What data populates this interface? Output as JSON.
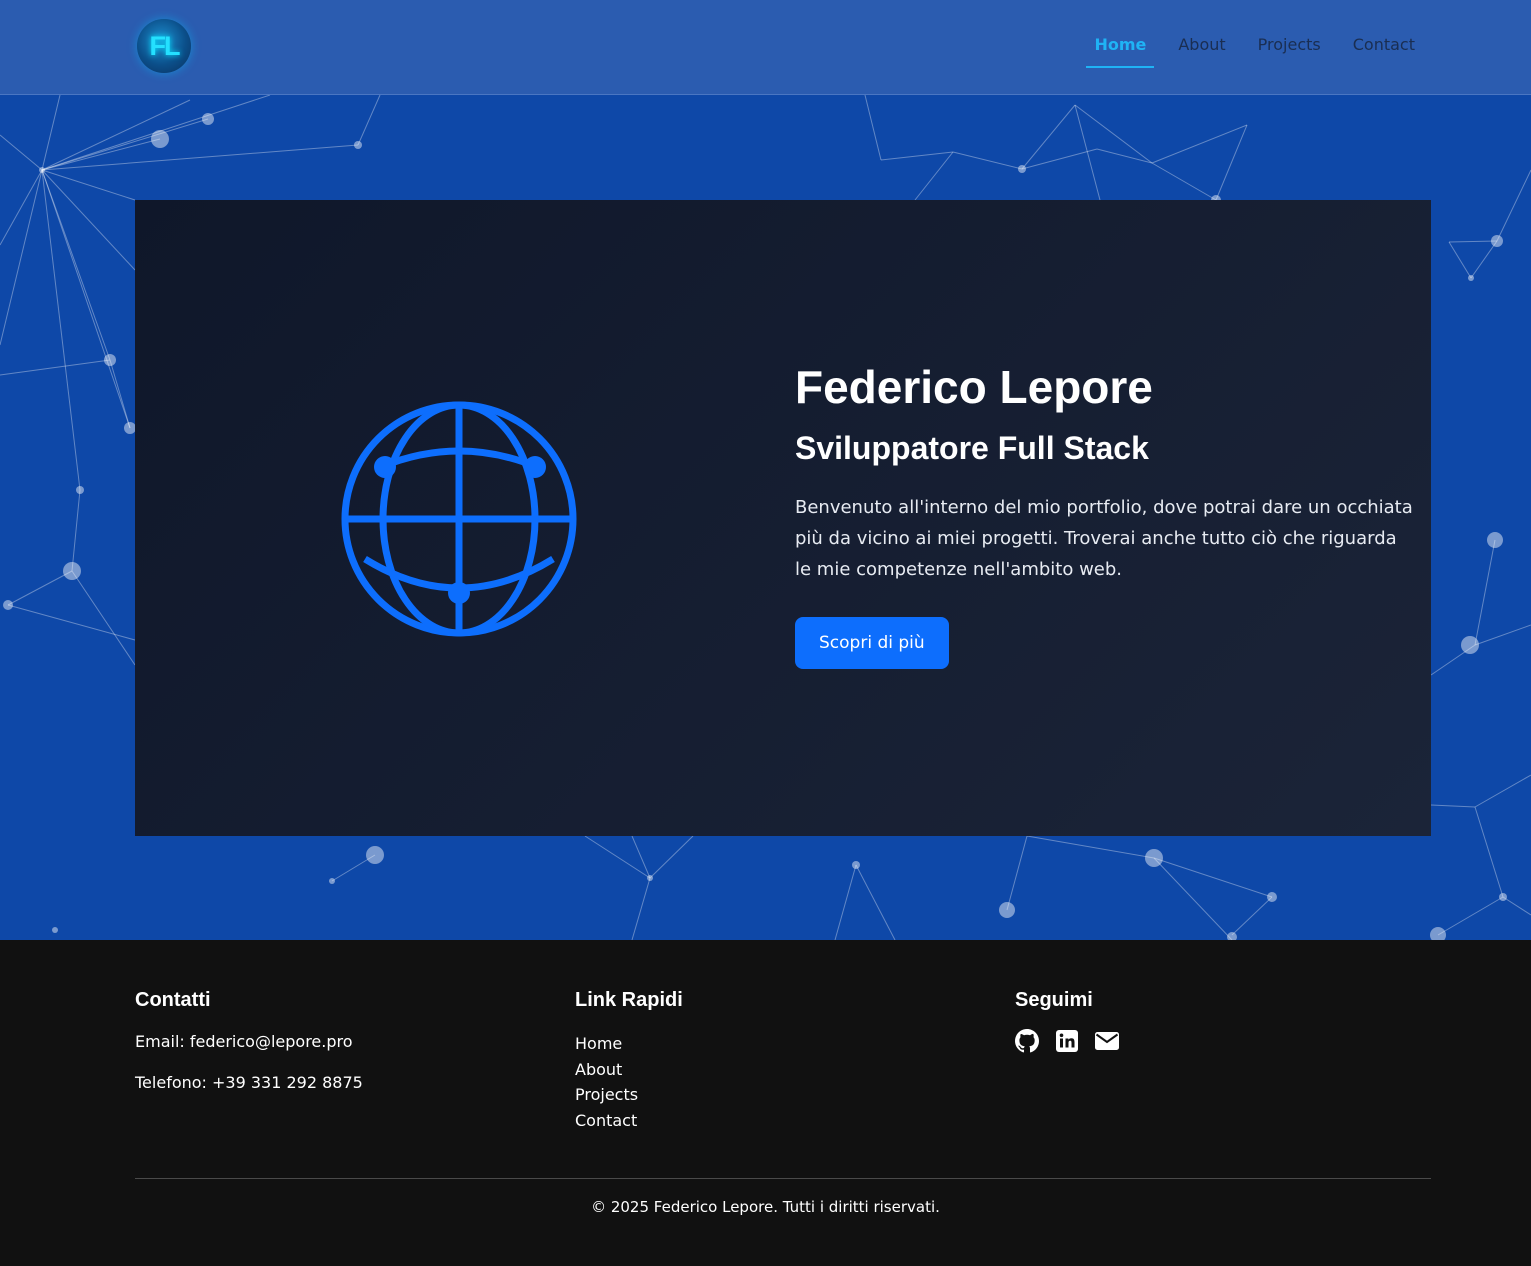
{
  "header": {
    "logo_text": "FL",
    "nav": [
      "Home",
      "About",
      "Projects",
      "Contact"
    ],
    "active_nav": "Home"
  },
  "hero": {
    "title": "Federico Lepore",
    "subtitle": "Sviluppatore Full Stack",
    "description": "Benvenuto all'interno del mio portfolio, dove potrai dare un occhiata più da vicino ai miei progetti. Troverai anche tutto ciò che riguarda le mie competenze nell'ambito web.",
    "cta_label": "Scopri di più",
    "icon": "globe-icon"
  },
  "footer": {
    "contacts": {
      "heading": "Contatti",
      "email": "Email: federico@lepore.pro",
      "phone": "Telefono: +39 331 292 8875"
    },
    "quick_links": {
      "heading": "Link Rapidi",
      "items": [
        "Home",
        "About",
        "Projects",
        "Contact"
      ]
    },
    "social": {
      "heading": "Seguimi",
      "icons": [
        "github-icon",
        "linkedin-icon",
        "email-icon"
      ]
    },
    "copyright": "© 2025 Federico Lepore. Tutti i diritti riservati."
  },
  "colors": {
    "header_bg": "#2b5cb0",
    "hero_bg": "#0e48a8",
    "card_bg": "#0f172a",
    "accent": "#0d6efd",
    "nav_active": "#1fb3f5",
    "footer_bg": "#111111"
  }
}
